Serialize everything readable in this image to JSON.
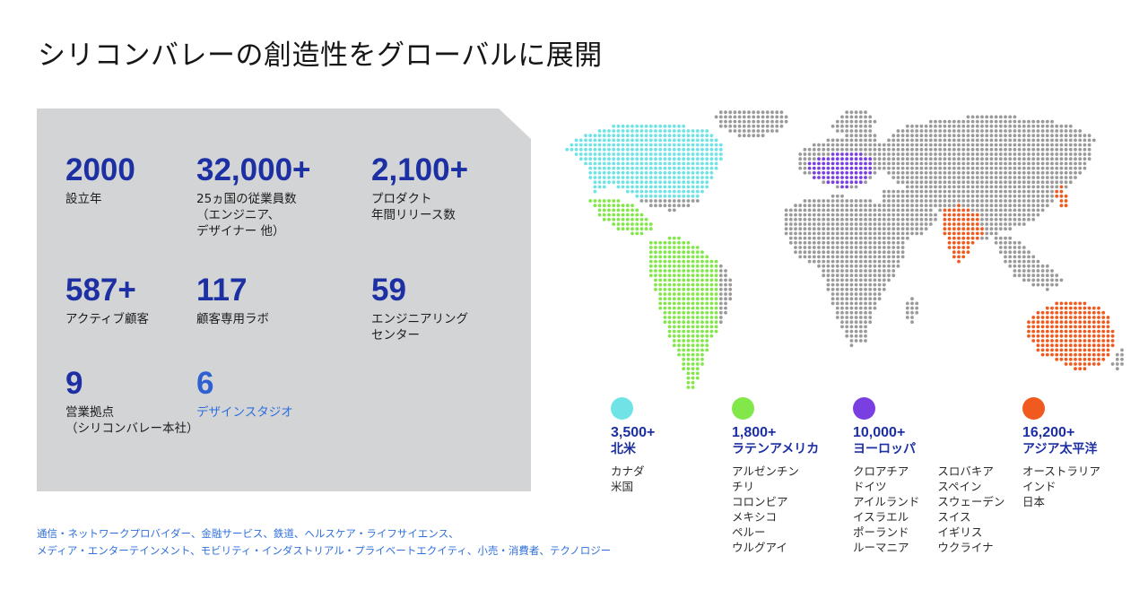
{
  "title": "シリコンバレーの創造性をグローバルに展開",
  "stats": [
    {
      "value": "2000",
      "label": "設立年"
    },
    {
      "value": "32,000+",
      "label": "25ヵ国の従業員数\n（エンジニア、\nデザイナー 他）"
    },
    {
      "value": "2,100+",
      "label": "プロダクト\n年間リリース数"
    },
    {
      "value": "587+",
      "label": "アクティブ顧客"
    },
    {
      "value": "117",
      "label": "顧客専用ラボ"
    },
    {
      "value": "59",
      "label": "エンジニアリング\nセンター"
    },
    {
      "value": "9",
      "label": "営業拠点\n（シリコンバレー本社）"
    },
    {
      "value": "6",
      "label": "デザインスタジオ"
    }
  ],
  "industries": {
    "line1": "通信・ネットワークプロバイダー、金融サービス、鉄道、ヘルスケア・ライフサイエンス、",
    "line2": "メディア・エンターテインメント、モビリティ・インダストリアル・プライベートエクイティ、小売・消費者、テクノロジー"
  },
  "colors": {
    "accent": "#1c2fa3",
    "link": "#2f6fdc",
    "panel": "#d3d4d6",
    "map_base": "#9a9a9a",
    "north_america": "#6fe3e6",
    "latin_america": "#82e84a",
    "europe": "#7a3fe0",
    "asia_pacific": "#f05a1e"
  },
  "regions": [
    {
      "count": "3,500+",
      "name": "北米",
      "color": "#6fe3e6",
      "columns": [
        [
          "カナダ",
          "米国"
        ]
      ]
    },
    {
      "count": "1,800+",
      "name": "ラテンアメリカ",
      "color": "#82e84a",
      "columns": [
        [
          "アルゼンチン",
          "チリ",
          "コロンビア",
          "メキシコ",
          "ペルー",
          "ウルグアイ"
        ]
      ]
    },
    {
      "count": "10,000+",
      "name": "ヨーロッパ",
      "color": "#7a3fe0",
      "columns": [
        [
          "クロアチア",
          "ドイツ",
          "アイルランド",
          "イスラエル",
          "ポーランド",
          "ルーマニア"
        ],
        [
          "スロバキア",
          "スペイン",
          "スウェーデン",
          "スイス",
          "イギリス",
          "ウクライナ"
        ]
      ]
    },
    {
      "count": "16,200+",
      "name": "アジア太平洋",
      "color": "#f05a1e",
      "columns": [
        [
          "オーストラリア",
          "インド",
          "日本"
        ]
      ]
    }
  ]
}
